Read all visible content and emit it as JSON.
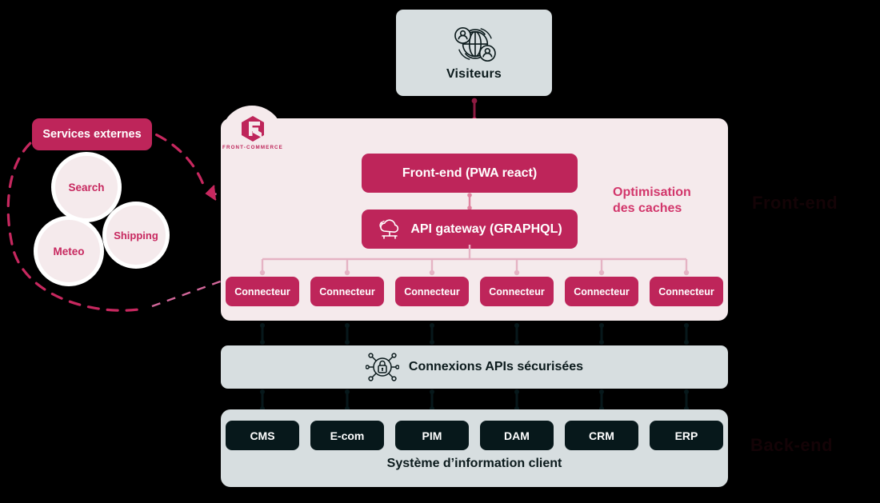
{
  "palette": {
    "background": "#000000",
    "crimson": "#BE255A",
    "crimson_light": "#D2366B",
    "panel_pink": "#F5EAEC",
    "panel_grey": "#D7DEE0",
    "dark_chip": "#07181B",
    "text_dark": "#0B1A1C",
    "white": "#FFFFFF",
    "faint_label": "#140306"
  },
  "visitors": {
    "label": "Visiteurs",
    "icon": "globe-users-icon"
  },
  "brand": {
    "logo_icon": "front-commerce-logo-icon",
    "wordmark": "FRONT-COMMERCE"
  },
  "frontend": {
    "label": "Front-end (PWA react)"
  },
  "gateway": {
    "label": "API gateway (GRAPHQL)",
    "icon": "cloud-network-icon"
  },
  "cache": {
    "line1": "Optimisation",
    "line2": "des caches",
    "full": "Optimisation des caches"
  },
  "connectors": {
    "label": "Connecteur",
    "items": [
      {
        "label": "Connecteur"
      },
      {
        "label": "Connecteur"
      },
      {
        "label": "Connecteur"
      },
      {
        "label": "Connecteur"
      },
      {
        "label": "Connecteur"
      },
      {
        "label": "Connecteur"
      }
    ]
  },
  "secure_apis": {
    "label": "Connexions APIs sécurisées",
    "icon": "lock-network-icon"
  },
  "client_system": {
    "caption": "Système d’information client",
    "chips": [
      {
        "label": "CMS"
      },
      {
        "label": "E-com"
      },
      {
        "label": "PIM"
      },
      {
        "label": "DAM"
      },
      {
        "label": "CRM"
      },
      {
        "label": "ERP"
      }
    ]
  },
  "external_services": {
    "badge": "Services externes",
    "bubbles": [
      {
        "label": "Search"
      },
      {
        "label": "Shipping"
      },
      {
        "label": "Meteo"
      }
    ]
  },
  "side_labels": {
    "top": "Front-end",
    "bottom": "Back-end"
  }
}
